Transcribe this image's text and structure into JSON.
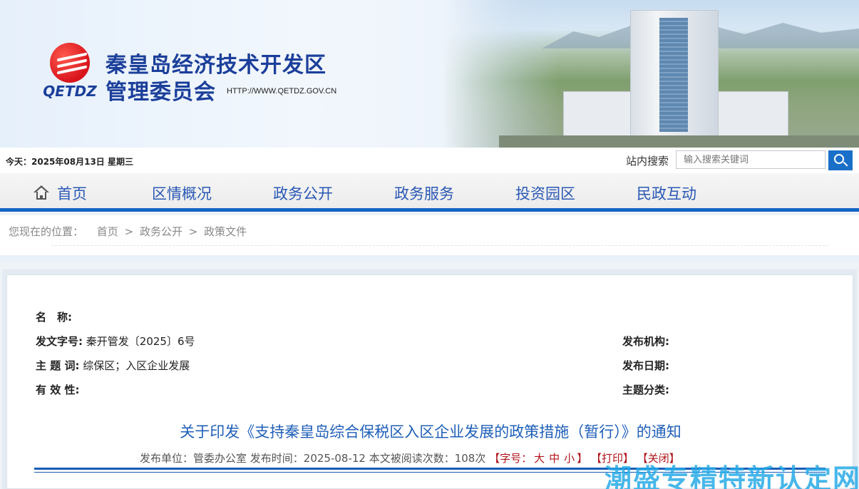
{
  "banner": {
    "logo_text": "QETDZ",
    "org_line1": "秦皇岛经济技术开发区",
    "org_line2": "管理委员会",
    "url": "HTTP://WWW.QETDZ.GOV.CN"
  },
  "infobar": {
    "date": "今天：2025年08月13日 星期三",
    "search_label": "站内搜索",
    "search_placeholder": "输入搜索关键词"
  },
  "nav": {
    "items": [
      "首页",
      "区情概况",
      "政务公开",
      "政务服务",
      "投资园区",
      "民政互动"
    ]
  },
  "breadcrumb": {
    "lead": "您现在的位置：",
    "path": [
      "首页",
      ">",
      "政务公开",
      ">",
      "政策文件"
    ]
  },
  "doc": {
    "name_label": "名　称:",
    "name_value": "",
    "docno_label": "发文字号:",
    "docno_value": "秦开管发〔2025〕6号",
    "keywords_label": "主 题 词:",
    "keywords_value": "综保区；入区企业发展",
    "validity_label": "有 效 性:",
    "validity_value": "",
    "agency_label": "发布机构:",
    "date_label": "发布日期:",
    "category_label": "主题分类:",
    "title": "关于印发《支持秦皇岛综合保税区入区企业发展的政策措施（暂行）》的通知",
    "pub_unit": "发布单位：管委办公室 发布时间：2025-08-12 本文被阅读次数：108次",
    "font_label": "【字号：",
    "font_big": "大",
    "font_mid": "中",
    "font_small": "小",
    "font_close": "】",
    "print": "【打印】",
    "close": "【关闭】"
  },
  "watermark": "潮盛专精特新认定网",
  "colors": {
    "brand_blue": "#1464c4",
    "nav_text": "#2a58b4",
    "title_blue": "#1f5fb8",
    "accent_red": "#b0141a"
  }
}
